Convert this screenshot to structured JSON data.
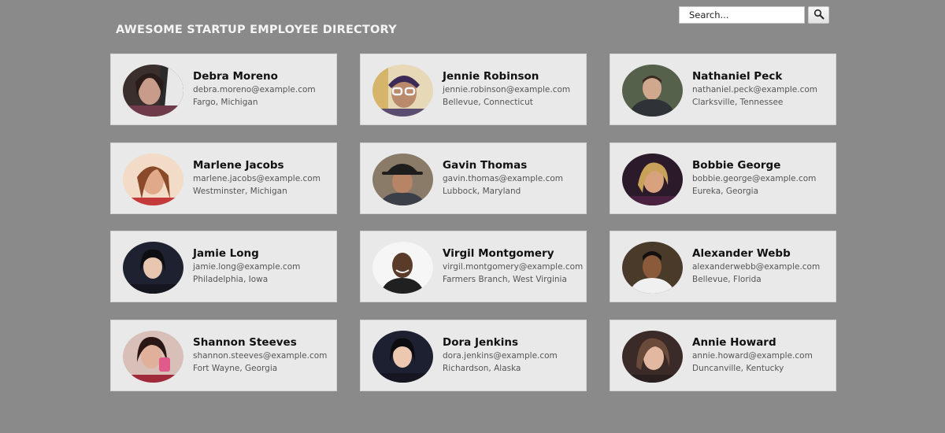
{
  "header": {
    "title": "AWESOME STARTUP EMPLOYEE DIRECTORY"
  },
  "search": {
    "placeholder": "Search...",
    "button_icon": "magnifier-icon"
  },
  "colors": {
    "page_background": "#8a8a8a",
    "card_background": "#e9e9e9",
    "title_text": "#f4f4f4"
  },
  "employees": [
    {
      "name": "Debra Moreno",
      "email": "debra.moreno@example.com",
      "location": "Fargo, Michigan"
    },
    {
      "name": "Jennie Robinson",
      "email": "jennie.robinson@example.com",
      "location": "Bellevue, Connecticut"
    },
    {
      "name": "Nathaniel Peck",
      "email": "nathaniel.peck@example.com",
      "location": "Clarksville, Tennessee"
    },
    {
      "name": "Marlene Jacobs",
      "email": "marlene.jacobs@example.com",
      "location": "Westminster, Michigan"
    },
    {
      "name": "Gavin Thomas",
      "email": "gavin.thomas@example.com",
      "location": "Lubbock, Maryland"
    },
    {
      "name": "Bobbie George",
      "email": "bobbie.george@example.com",
      "location": "Eureka, Georgia"
    },
    {
      "name": "Jamie Long",
      "email": "jamie.long@example.com",
      "location": "Philadelphia, Iowa"
    },
    {
      "name": "Virgil Montgomery",
      "email": "virgil.montgomery@example.com",
      "location": "Farmers Branch, West Virginia"
    },
    {
      "name": "Alexander Webb",
      "email": "alexanderwebb@example.com",
      "location": "Bellevue, Florida"
    },
    {
      "name": "Shannon Steeves",
      "email": "shannon.steeves@example.com",
      "location": "Fort Wayne, Georgia"
    },
    {
      "name": "Dora Jenkins",
      "email": "dora.jenkins@example.com",
      "location": "Richardson, Alaska"
    },
    {
      "name": "Annie Howard",
      "email": "annie.howard@example.com",
      "location": "Duncanville, Kentucky"
    }
  ]
}
